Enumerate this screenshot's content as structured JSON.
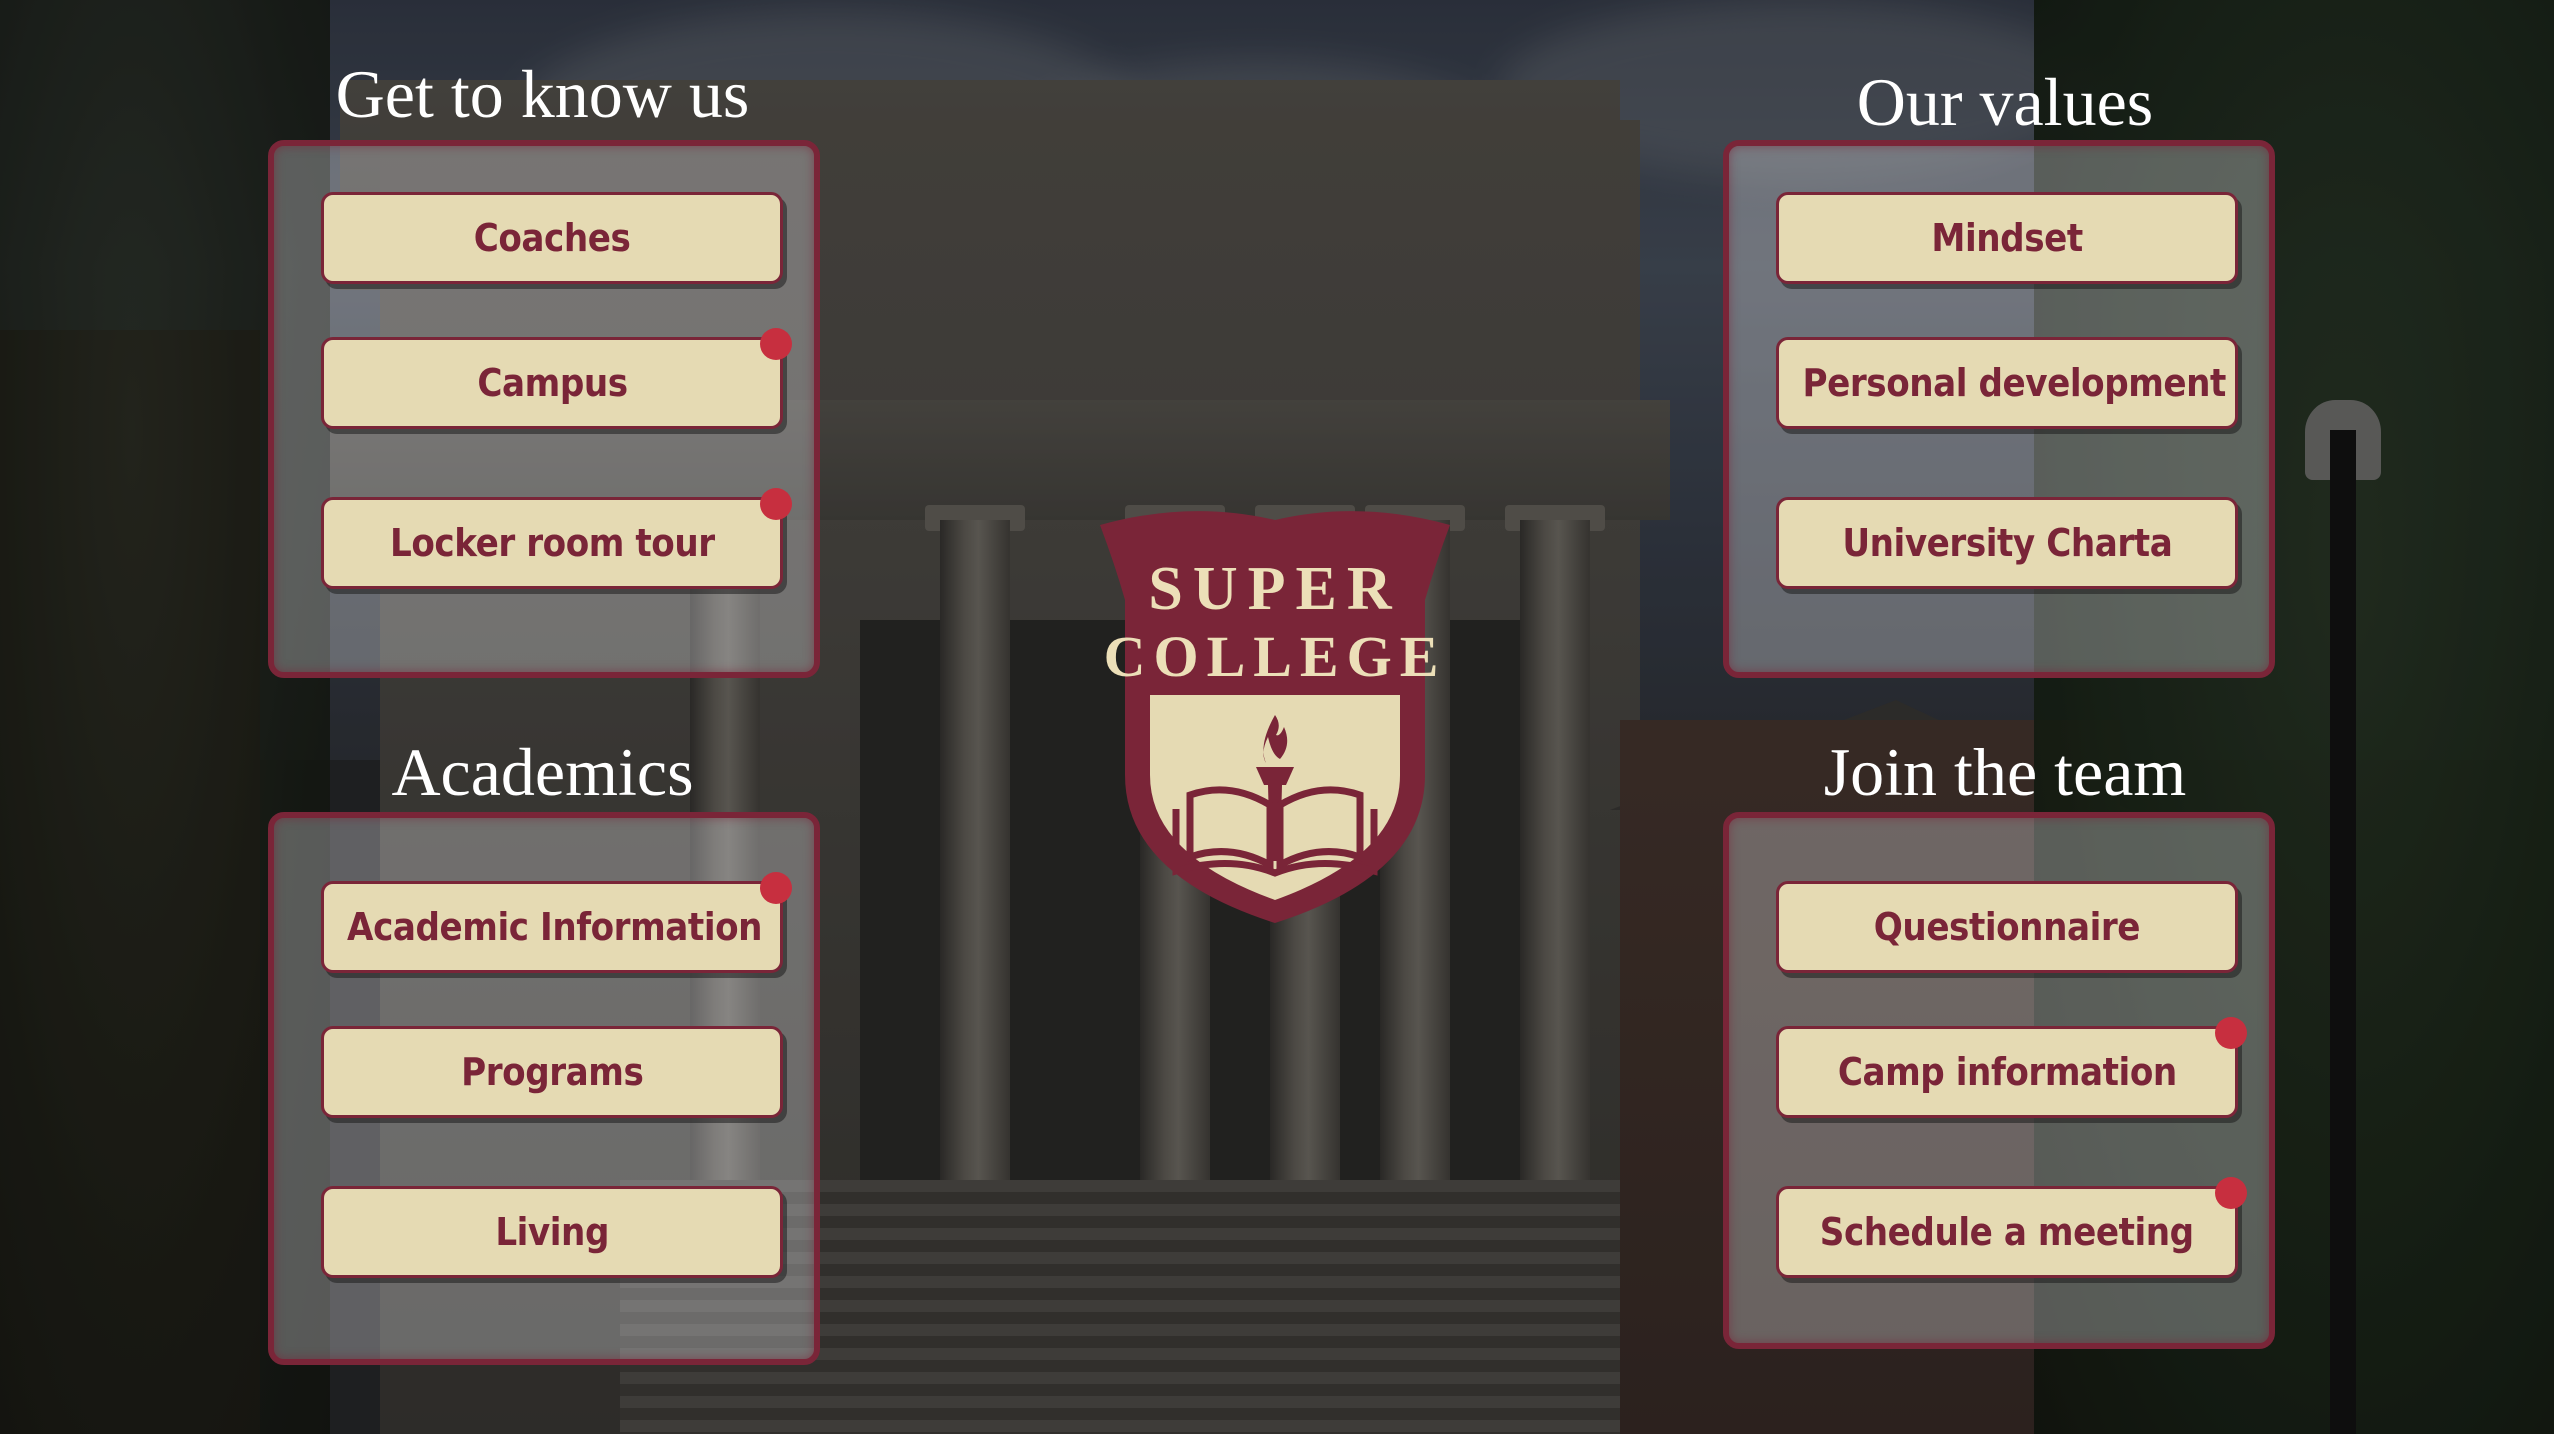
{
  "sections": {
    "get_to_know_us": {
      "title": "Get to know us",
      "buttons": [
        {
          "label": "Coaches",
          "notification": false
        },
        {
          "label": "Campus",
          "notification": true
        },
        {
          "label": "Locker room tour",
          "notification": true
        }
      ]
    },
    "our_values": {
      "title": "Our values",
      "buttons": [
        {
          "label": "Mindset",
          "notification": false
        },
        {
          "label": "Personal development",
          "notification": false
        },
        {
          "label": "University Charta",
          "notification": false
        }
      ]
    },
    "academics": {
      "title": "Academics",
      "buttons": [
        {
          "label": "Academic Information",
          "notification": true
        },
        {
          "label": "Programs",
          "notification": false
        },
        {
          "label": "Living",
          "notification": false
        }
      ]
    },
    "join_the_team": {
      "title": "Join the team",
      "buttons": [
        {
          "label": "Questionnaire",
          "notification": false
        },
        {
          "label": "Camp information",
          "notification": true
        },
        {
          "label": "Schedule a meeting",
          "notification": true
        }
      ]
    }
  },
  "logo": {
    "line1": "SUPER",
    "line2": "COLLEGE",
    "icon": "torch-book-icon"
  },
  "colors": {
    "brand_maroon": "#7a2538",
    "button_cream": "#e5dab3",
    "notification_dot": "#c72f3f",
    "logo_text": "#ecdfb8"
  }
}
